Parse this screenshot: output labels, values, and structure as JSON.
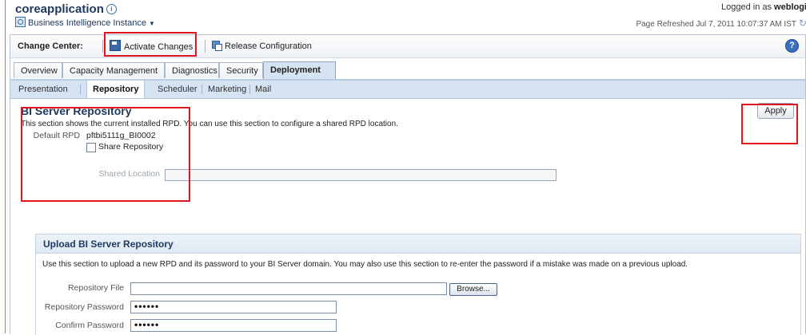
{
  "header": {
    "app_title": "coreapplication",
    "instance_label": "Business Intelligence Instance",
    "logged_in_prefix": "Logged in as",
    "logged_in_user": "weblogi",
    "page_refreshed": "Page Refreshed Jul 7, 2011 10:07:37 AM IST"
  },
  "toolbar": {
    "change_center_label": "Change Center:",
    "activate_changes_label": "Activate Changes",
    "release_configuration_label": "Release Configuration"
  },
  "tabs": [
    {
      "label": "Overview"
    },
    {
      "label": "Capacity Management"
    },
    {
      "label": "Diagnostics"
    },
    {
      "label": "Security"
    },
    {
      "label": "Deployment"
    }
  ],
  "subtabs": [
    {
      "label": "Presentation"
    },
    {
      "label": "Repository"
    },
    {
      "label": "Scheduler"
    },
    {
      "label": "Marketing"
    },
    {
      "label": "Mail"
    }
  ],
  "repository": {
    "title": "BI Server Repository",
    "description": "This section shows the current installed RPD. You can use this section to configure a shared RPD location.",
    "default_rpd_label": "Default RPD",
    "default_rpd_value": "pftbi5111g_BI0002",
    "share_repository_label": "Share Repository",
    "shared_location_label": "Shared Location",
    "apply_label": "Apply"
  },
  "upload": {
    "title": "Upload BI Server Repository",
    "description": "Use this section to upload a new RPD and its password to your BI Server domain. You may also use this section to re-enter the password if a mistake was made on a previous upload.",
    "repository_file_label": "Repository File",
    "browse_label": "Browse...",
    "repository_password_label": "Repository Password",
    "repository_password_value": "••••••",
    "confirm_password_label": "Confirm Password",
    "confirm_password_value": "••••••"
  }
}
